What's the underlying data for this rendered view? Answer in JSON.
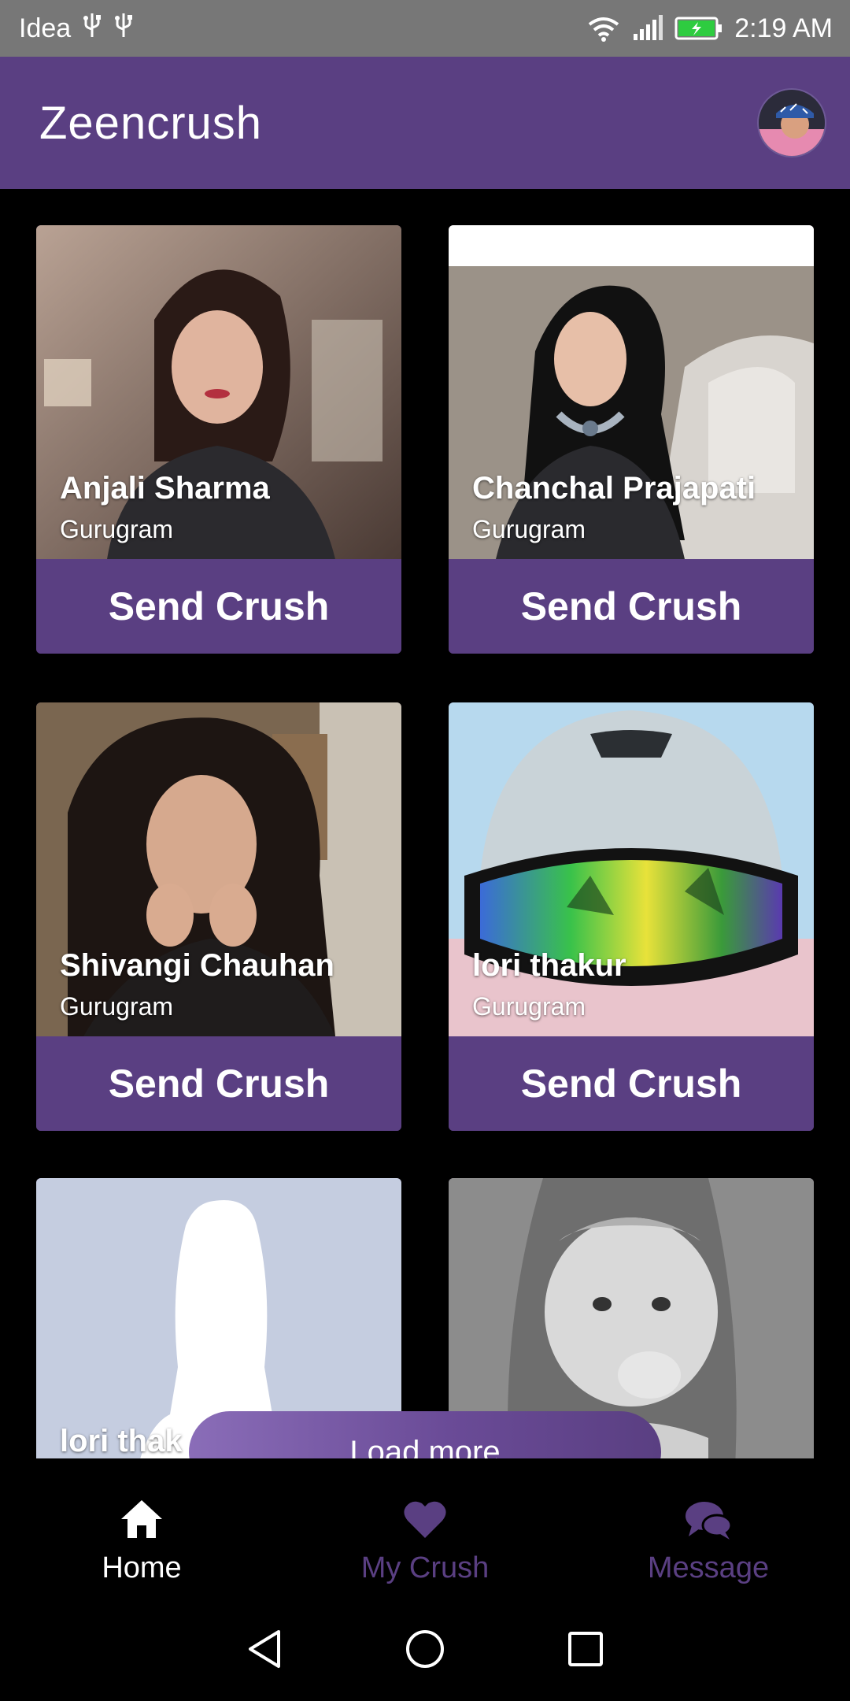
{
  "status_bar": {
    "carrier": "Idea",
    "time": "2:19 AM",
    "icons": [
      "usb-icon",
      "usb-icon",
      "wifi-icon",
      "signal-icon",
      "battery-charging-icon"
    ]
  },
  "app_bar": {
    "title": "Zeencrush"
  },
  "cards": [
    {
      "name": "Anjali Sharma",
      "city": "Gurugram",
      "button": "Send Crush"
    },
    {
      "name": "Chanchal Prajapati",
      "city": "Gurugram",
      "button": "Send Crush"
    },
    {
      "name": "Shivangi Chauhan",
      "city": "Gurugram",
      "button": "Send Crush"
    },
    {
      "name": "lori thakur",
      "city": "Gurugram",
      "button": "Send Crush"
    },
    {
      "name": "lori thak",
      "city": "",
      "button": ""
    },
    {
      "name": "",
      "city": "",
      "button": ""
    }
  ],
  "load_more": {
    "label": "Load more"
  },
  "bottom_nav": {
    "items": [
      {
        "label": "Home",
        "icon": "home-icon",
        "active": true
      },
      {
        "label": "My Crush",
        "icon": "heart-icon",
        "active": false
      },
      {
        "label": "Message",
        "icon": "chat-bubbles-icon",
        "active": false
      }
    ]
  },
  "android_nav": {
    "icons": [
      "back-icon",
      "home-circle-icon",
      "recents-icon"
    ]
  },
  "colors": {
    "accent": "#5a3f82",
    "status_bar": "#777777",
    "background": "#000000"
  }
}
